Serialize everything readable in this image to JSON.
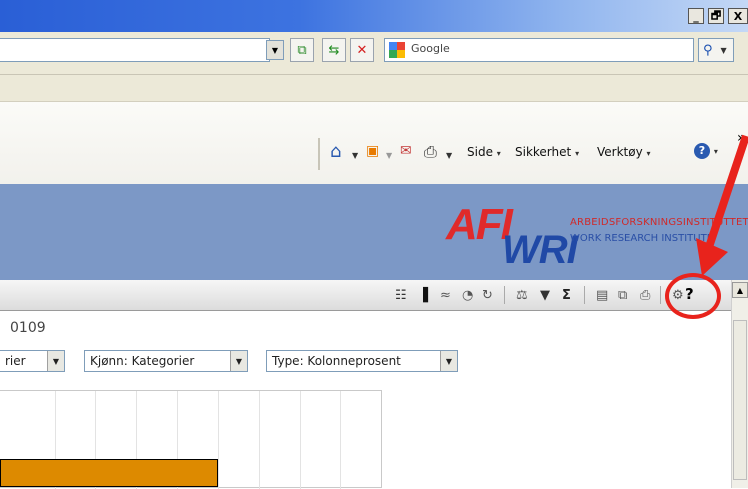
{
  "window": {
    "controls": [
      "_",
      "🗗",
      "X"
    ]
  },
  "search": {
    "placeholder": "Google"
  },
  "command_bar": {
    "overflow": "»",
    "items": [
      {
        "label": "Side",
        "arrow": "▾"
      },
      {
        "label": "Sikkerhet",
        "arrow": "▾"
      },
      {
        "label": "Verktøy",
        "arrow": "▾"
      }
    ],
    "help_arrow": "▾"
  },
  "banner": {
    "logo_top": "AFI",
    "logo_bottom": "WRI",
    "name_no": "ARBEIDSFORSKNINGSINSTITUTTET",
    "name_en": "WORK RESEARCH INSTITUTE"
  },
  "report": {
    "title": "0109",
    "help_symbol": "?",
    "selectors": [
      {
        "value": "rier"
      },
      {
        "value": "Kjønn: Kategorier"
      },
      {
        "value": "Type: Kolonneprosent"
      }
    ]
  },
  "chart_data": {
    "type": "bar",
    "orientation": "horizontal",
    "values": [
      0.57
    ],
    "colors": {
      "bar": "#dd8a00"
    },
    "grid": true
  },
  "colors": {
    "title_bar": "#2a5fd6",
    "banner": "#7c98c6",
    "annotation": "#e8231c"
  }
}
